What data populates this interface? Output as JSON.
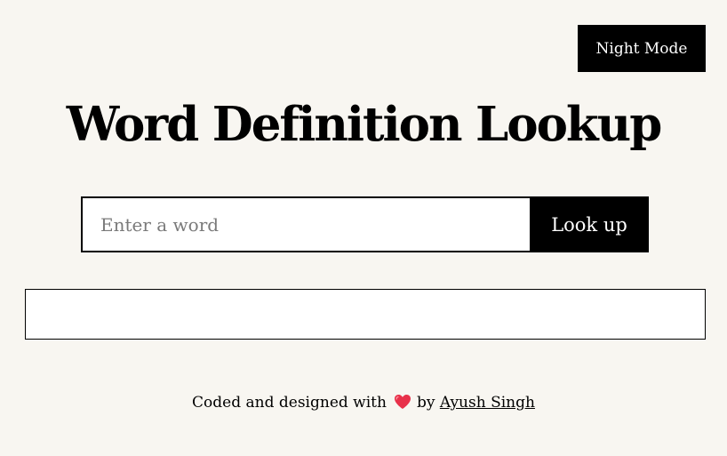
{
  "header": {
    "night_mode_label": "Night Mode"
  },
  "title": "Word Definition Lookup",
  "search": {
    "placeholder": "Enter a word",
    "value": "",
    "button_label": "Look up"
  },
  "result": {
    "text": ""
  },
  "footer": {
    "prefix": "Coded and designed with",
    "icon": "heart-icon",
    "by": "by",
    "author": "Ayush Singh"
  },
  "colors": {
    "background": "#f8f6f1",
    "accent": "#000000",
    "heart": "#e8314a"
  }
}
